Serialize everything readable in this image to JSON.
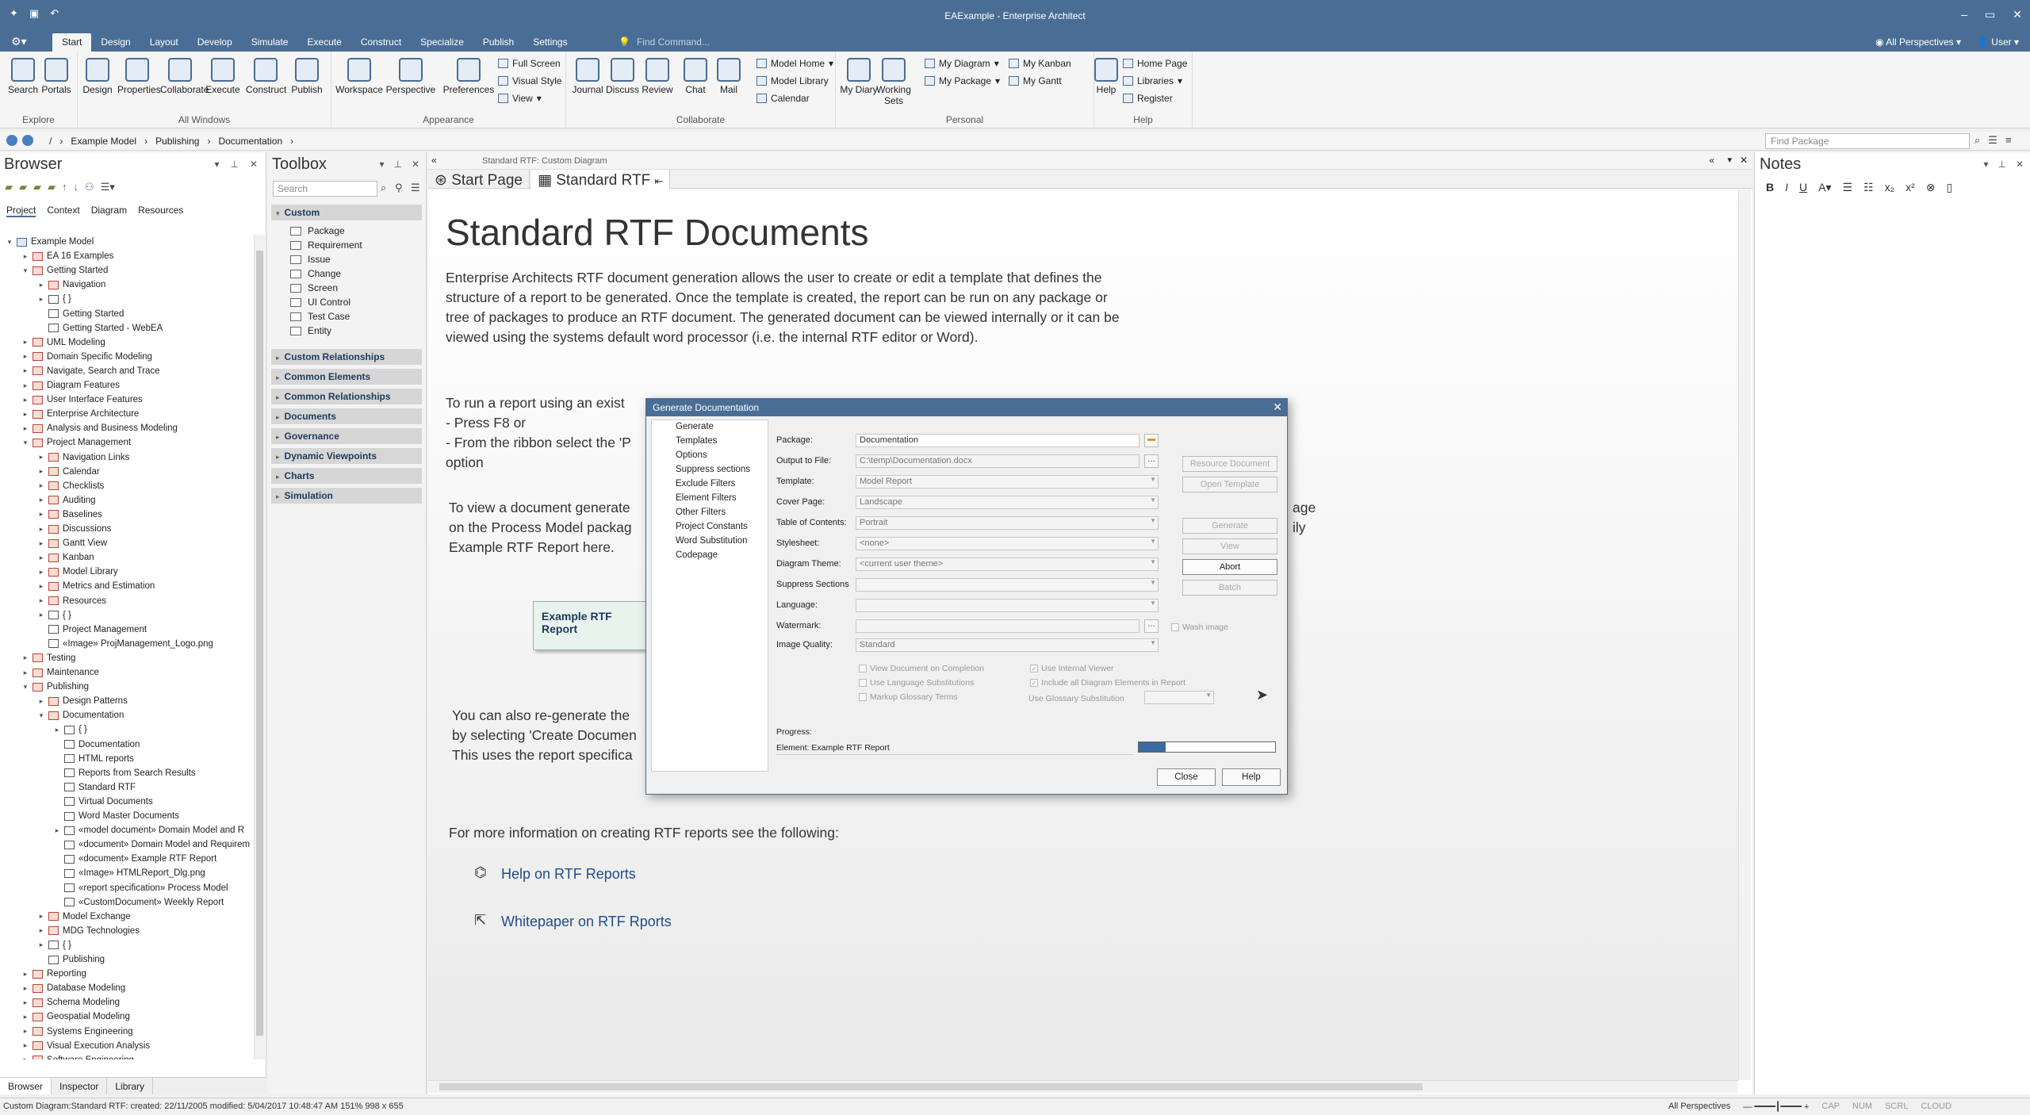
{
  "window": {
    "title": "EAExample - Enterprise Architect"
  },
  "menu": {
    "tabs": [
      "Start",
      "Design",
      "Layout",
      "Develop",
      "Simulate",
      "Execute",
      "Construct",
      "Specialize",
      "Publish",
      "Settings"
    ],
    "active": "Start",
    "find_placeholder": "Find Command...",
    "perspectives": "All Perspectives",
    "user": "User"
  },
  "ribbon": {
    "explore": {
      "name": "Explore",
      "buttons": [
        "Search",
        "Portals"
      ]
    },
    "all_windows": {
      "name": "All Windows",
      "buttons": [
        "Design",
        "Properties",
        "Collaborate",
        "Execute",
        "Construct",
        "Publish"
      ]
    },
    "appearance": {
      "name": "Appearance",
      "buttons": [
        "Workspace",
        "Perspective",
        "Preferences"
      ],
      "small": [
        "Full Screen",
        "Visual Style",
        "View"
      ]
    },
    "collaborate": {
      "name": "Collaborate",
      "buttons": [
        "Journal",
        "Discuss",
        "Review",
        "Chat",
        "Mail"
      ],
      "small": [
        "Model Home",
        "Model Library",
        "Calendar"
      ]
    },
    "personal": {
      "name": "Personal",
      "buttons": [
        "My Diary",
        "Working Sets"
      ],
      "small": [
        "My Diagram",
        "My Package",
        "My Kanban",
        "My Gantt"
      ]
    },
    "help": {
      "name": "Help",
      "buttons": [
        "Help"
      ],
      "small": [
        "Home Page",
        "Libraries",
        "Register"
      ]
    }
  },
  "breadcrumb": {
    "items": [
      "/",
      "Example Model",
      "Publishing",
      "Documentation"
    ],
    "find_package_placeholder": "Find Package"
  },
  "browser": {
    "title": "Browser",
    "subtabs": [
      "Project",
      "Context",
      "Diagram",
      "Resources"
    ],
    "bottom_tabs": [
      "Browser",
      "Inspector",
      "Library"
    ],
    "tree": [
      {
        "label": "Example Model",
        "level": 0,
        "exp": "⌄",
        "icon": "pkg0"
      },
      {
        "label": "EA 16 Examples",
        "level": 1,
        "exp": "›"
      },
      {
        "label": "Getting Started",
        "level": 1,
        "exp": "⌄"
      },
      {
        "label": "Navigation",
        "level": 2,
        "exp": "›"
      },
      {
        "label": "{ }",
        "level": 2,
        "exp": "›",
        "icon": "diag"
      },
      {
        "label": "Getting Started",
        "level": 2,
        "exp": "",
        "icon": "diag"
      },
      {
        "label": "Getting Started - WebEA",
        "level": 2,
        "exp": "",
        "icon": "diag"
      },
      {
        "label": "UML Modeling",
        "level": 1,
        "exp": "›"
      },
      {
        "label": "Domain Specific Modeling",
        "level": 1,
        "exp": "›"
      },
      {
        "label": "Navigate, Search and Trace",
        "level": 1,
        "exp": "›"
      },
      {
        "label": "Diagram Features",
        "level": 1,
        "exp": "›"
      },
      {
        "label": "User Interface Features",
        "level": 1,
        "exp": "›"
      },
      {
        "label": "Enterprise Architecture",
        "level": 1,
        "exp": "›"
      },
      {
        "label": "Analysis and Business Modeling",
        "level": 1,
        "exp": "›"
      },
      {
        "label": "Project Management",
        "level": 1,
        "exp": "⌄"
      },
      {
        "label": "Navigation Links",
        "level": 2,
        "exp": "›"
      },
      {
        "label": "Calendar",
        "level": 2,
        "exp": "›"
      },
      {
        "label": "Checklists",
        "level": 2,
        "exp": "›"
      },
      {
        "label": "Auditing",
        "level": 2,
        "exp": "›"
      },
      {
        "label": "Baselines",
        "level": 2,
        "exp": "›"
      },
      {
        "label": "Discussions",
        "level": 2,
        "exp": "›"
      },
      {
        "label": "Gantt View",
        "level": 2,
        "exp": "›"
      },
      {
        "label": "Kanban",
        "level": 2,
        "exp": "›"
      },
      {
        "label": "Model Library",
        "level": 2,
        "exp": "›"
      },
      {
        "label": "Metrics and Estimation",
        "level": 2,
        "exp": "›"
      },
      {
        "label": "Resources",
        "level": 2,
        "exp": "›"
      },
      {
        "label": "{ }",
        "level": 2,
        "exp": "›",
        "icon": "diag"
      },
      {
        "label": "Project Management",
        "level": 2,
        "exp": "",
        "icon": "diag"
      },
      {
        "label": "«Image» ProjManagement_Logo.png",
        "level": 2,
        "exp": "",
        "icon": "diag"
      },
      {
        "label": "Testing",
        "level": 1,
        "exp": "›"
      },
      {
        "label": "Maintenance",
        "level": 1,
        "exp": "›"
      },
      {
        "label": "Publishing",
        "level": 1,
        "exp": "⌄"
      },
      {
        "label": "Design Patterns",
        "level": 2,
        "exp": "›"
      },
      {
        "label": "Documentation",
        "level": 2,
        "exp": "⌄"
      },
      {
        "label": "{ }",
        "level": 3,
        "exp": "›",
        "icon": "diag"
      },
      {
        "label": "Documentation",
        "level": 3,
        "exp": "",
        "icon": "diag"
      },
      {
        "label": "HTML reports",
        "level": 3,
        "exp": "",
        "icon": "diag"
      },
      {
        "label": "Reports from Search Results",
        "level": 3,
        "exp": "",
        "icon": "diag"
      },
      {
        "label": "Standard RTF",
        "level": 3,
        "exp": "",
        "icon": "diag"
      },
      {
        "label": "Virtual Documents",
        "level": 3,
        "exp": "",
        "icon": "diag"
      },
      {
        "label": "Word Master Documents",
        "level": 3,
        "exp": "",
        "icon": "diag"
      },
      {
        "label": "«model document» Domain Model and R",
        "level": 3,
        "exp": "›",
        "icon": "diag"
      },
      {
        "label": "«document» Domain Model and Requirem",
        "level": 3,
        "exp": "",
        "icon": "diag"
      },
      {
        "label": "«document» Example RTF Report",
        "level": 3,
        "exp": "",
        "icon": "diag"
      },
      {
        "label": "«Image» HTMLReport_Dlg.png",
        "level": 3,
        "exp": "",
        "icon": "diag"
      },
      {
        "label": "«report specification» Process Model",
        "level": 3,
        "exp": "",
        "icon": "diag"
      },
      {
        "label": "«CustomDocument» Weekly Report",
        "level": 3,
        "exp": "",
        "icon": "diag"
      },
      {
        "label": "Model Exchange",
        "level": 2,
        "exp": "›"
      },
      {
        "label": "MDG Technologies",
        "level": 2,
        "exp": "›"
      },
      {
        "label": "{ }",
        "level": 2,
        "exp": "›",
        "icon": "diag"
      },
      {
        "label": "Publishing",
        "level": 2,
        "exp": "",
        "icon": "diag"
      },
      {
        "label": "Reporting",
        "level": 1,
        "exp": "›"
      },
      {
        "label": "Database Modeling",
        "level": 1,
        "exp": "›"
      },
      {
        "label": "Schema Modeling",
        "level": 1,
        "exp": "›"
      },
      {
        "label": "Geospatial Modeling",
        "level": 1,
        "exp": "›"
      },
      {
        "label": "Systems Engineering",
        "level": 1,
        "exp": "›"
      },
      {
        "label": "Visual Execution Analysis",
        "level": 1,
        "exp": "›"
      },
      {
        "label": "Software Engineering",
        "level": 1,
        "exp": "›"
      }
    ]
  },
  "toolbox": {
    "title": "Toolbox",
    "search_placeholder": "Search",
    "custom_header": "Custom",
    "custom_items": [
      "Package",
      "Requirement",
      "Issue",
      "Change",
      "Screen",
      "UI Control",
      "Test Case",
      "Entity"
    ],
    "sections": [
      "Custom Relationships",
      "Common Elements",
      "Common Relationships",
      "Documents",
      "Governance",
      "Dynamic Viewpoints",
      "Charts",
      "Simulation"
    ]
  },
  "center": {
    "strip_title": "Standard RTF:  Custom Diagram",
    "tabs": [
      "Start Page",
      "Standard RTF"
    ],
    "heading": "Standard RTF Documents",
    "para1": [
      "Enterprise Architects RTF document generation allows the user to create or edit a template that defines the",
      "structure of a report to be generated.  Once the template is created, the report can be run on any package or",
      "tree of packages to produce an RTF document.  The generated document can be viewed internally or it can be",
      "viewed using the systems default word processor (i.e. the internal RTF editor or Word)."
    ],
    "para2": [
      "To run a report using an exist",
      "- Press F8 or",
      "- From the ribbon select the 'P",
      "option"
    ],
    "para3": [
      "To view a document generate",
      "on the Process Model packag",
      "Example RTF Report here."
    ],
    "para3_right": [
      "age",
      "ily"
    ],
    "rtf_box": "Example RTF Report",
    "para4": [
      "You can also re-generate the",
      "by selecting 'Create Documen",
      "This uses the report specifica"
    ],
    "more_info": "For more information on creating RTF reports see the following:",
    "link1": "Help on RTF Reports",
    "link2": "Whitepaper on RTF Rports"
  },
  "notes": {
    "title": "Notes"
  },
  "dialog": {
    "title": "Generate Documentation",
    "nav": [
      "Generate",
      "Templates",
      "Options",
      "Suppress sections",
      "Exclude Filters",
      "Element Filters",
      "Other Filters",
      "Project Constants",
      "Word Substitution",
      "Codepage"
    ],
    "labels": {
      "package": "Package:",
      "output": "Output to File:",
      "template": "Template:",
      "cover": "Cover Page:",
      "toc": "Table of Contents:",
      "stylesheet": "Stylesheet:",
      "theme": "Diagram Theme:",
      "suppress": "Suppress Sections",
      "language": "Language:",
      "watermark": "Watermark:",
      "quality": "Image Quality:"
    },
    "values": {
      "package": "Documentation",
      "output": "C:\\temp\\Documentation.docx",
      "template": "Model Report",
      "cover": "Landscape",
      "toc": "Portrait",
      "stylesheet": "<none>",
      "theme": "<current user theme>",
      "suppress": "",
      "language": "",
      "watermark": "",
      "quality": "Standard"
    },
    "wash_image": "Wash image",
    "buttons_right": [
      "Resource Document",
      "Open Template",
      "Generate",
      "View",
      "Abort",
      "Batch"
    ],
    "checks": {
      "view_completion": "View Document on Completion",
      "use_internal": "Use Internal Viewer",
      "use_lang": "Use Language Substitutions",
      "include_all": "Include all Diagram Elements in Report",
      "markup": "Markup Glossary Terms",
      "use_glossary": "Use Glossary Substitution"
    },
    "progress_label": "Progress:",
    "progress_element": "Element: Example RTF Report",
    "progress_value": 0.2,
    "close": "Close",
    "help": "Help"
  },
  "status": {
    "left": "Custom Diagram:Standard RTF:  created: 22/11/2005  modified: 5/04/2017 10:48:47 AM   151%   998 x 655",
    "perspectives": "All Perspectives",
    "indicators": [
      "CAP",
      "NUM",
      "SCRL",
      "CLOUD"
    ]
  }
}
